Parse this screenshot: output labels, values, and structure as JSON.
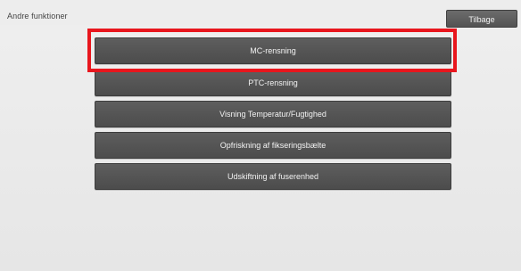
{
  "header": {
    "title": "Andre funktioner",
    "back_label": "Tilbage"
  },
  "menu": {
    "items": [
      {
        "label": "MC-rensning"
      },
      {
        "label": "PTC-rensning"
      },
      {
        "label": "Visning Temperatur/Fugtighed"
      },
      {
        "label": "Opfriskning af fikseringsbælte"
      },
      {
        "label": "Udskiftning af fuserenhed"
      }
    ]
  },
  "highlight_color": "#e8161d"
}
